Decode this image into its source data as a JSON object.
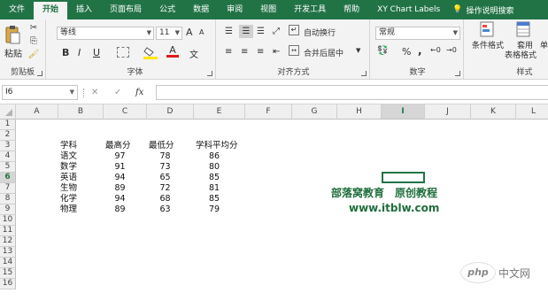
{
  "tabs": [
    "文件",
    "开始",
    "插入",
    "页面布局",
    "公式",
    "数据",
    "审阅",
    "视图",
    "开发工具",
    "帮助",
    "XY Chart Labels"
  ],
  "tell_me": "操作说明搜索",
  "ribbon": {
    "clipboard": {
      "paste": "粘贴",
      "label": "剪贴板"
    },
    "font": {
      "name": "等线",
      "size": "11",
      "label": "字体",
      "bold": "B",
      "italic": "I",
      "underline": "U",
      "grow": "A",
      "shrink": "A",
      "color": "A",
      "wen": "文"
    },
    "alignment": {
      "wrap": "自动换行",
      "merge": "合并后居中",
      "label": "对齐方式"
    },
    "number": {
      "format": "常规",
      "percent": "%",
      "comma": ",",
      "label": "数字"
    },
    "styles": {
      "conditional": "条件格式",
      "table_line1": "套用",
      "table_line2": "表格格式",
      "label": "样式",
      "cell_style": "单"
    }
  },
  "formula_bar": {
    "cell_ref": "I6",
    "fx": "fx",
    "cancel": "✕",
    "enter": "✓",
    "value": ""
  },
  "columns": [
    "A",
    "B",
    "C",
    "D",
    "E",
    "F",
    "G",
    "H",
    "I",
    "J",
    "K",
    "L"
  ],
  "rows": [
    "1",
    "2",
    "3",
    "4",
    "5",
    "6",
    "7",
    "8",
    "9",
    "10",
    "11",
    "12",
    "13",
    "14",
    "15",
    "16"
  ],
  "selected": {
    "col": "I",
    "row": "6"
  },
  "table": {
    "headers": [
      "学科",
      "最高分",
      "最低分",
      "学科平均分"
    ],
    "rows": [
      [
        "语文",
        "97",
        "78",
        "86"
      ],
      [
        "数学",
        "91",
        "73",
        "80"
      ],
      [
        "英语",
        "94",
        "65",
        "85"
      ],
      [
        "生物",
        "89",
        "72",
        "81"
      ],
      [
        "化学",
        "94",
        "68",
        "85"
      ],
      [
        "物理",
        "89",
        "63",
        "79"
      ]
    ]
  },
  "watermark": {
    "line1": "部落窝教育　原创教程",
    "line2": "www.itblw.com"
  },
  "php_badge": {
    "logo": "php",
    "text": "中文网"
  }
}
